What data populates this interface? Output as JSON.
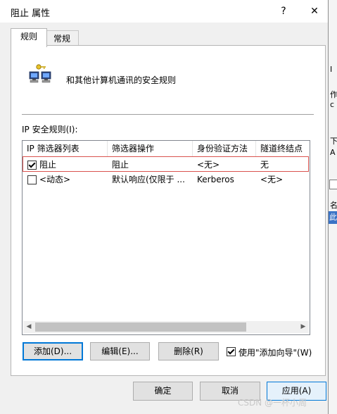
{
  "window": {
    "title": "阻止 属性",
    "help": "?",
    "close": "✕"
  },
  "tabs": [
    {
      "label": "规则"
    },
    {
      "label": "常规"
    }
  ],
  "header": {
    "description": "和其他计算机通讯的安全规则"
  },
  "rules_label": "IP 安全规则(I):",
  "table": {
    "columns": [
      "IP 筛选器列表",
      "筛选器操作",
      "身份验证方法",
      "隧道终结点"
    ],
    "rows": [
      {
        "checked": true,
        "cells": [
          "阻止",
          "阻止",
          "<无>",
          "无"
        ]
      },
      {
        "checked": false,
        "cells": [
          "<动态>",
          "默认响应(仅限于 ...",
          "Kerberos",
          "<无>"
        ]
      }
    ]
  },
  "actions": {
    "add": "添加(D)...",
    "edit": "编辑(E)...",
    "delete": "删除(R)",
    "wizard_label": "使用\"添加向导\"(W)",
    "wizard_checked": true
  },
  "footer": {
    "ok": "确定",
    "cancel": "取消",
    "apply": "应用(A)"
  },
  "background_window": {
    "fragments": [
      "I",
      "作",
      "c",
      "下",
      "A",
      "名",
      "此"
    ]
  },
  "watermark": "CSDN @一杯小周",
  "colors": {
    "accent": "#0078d7",
    "selection_border": "#d9534f"
  }
}
